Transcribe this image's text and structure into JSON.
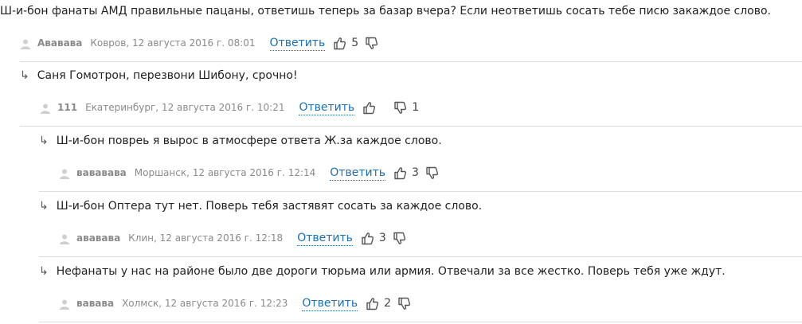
{
  "comments": [
    {
      "arrow": "",
      "text": "Ш-и-бон фанаты АМД правильные пацаны, ответишь теперь за базар вчера? Если неответишь сосать тебе писю закаждое слово.",
      "author": "Ававава",
      "location": "Ковров, 12 августа 2016 г. 08:01",
      "reply": "Ответить",
      "likes": "5",
      "dislikes": ""
    },
    {
      "arrow": "↳",
      "text": "Саня Гомотрон, перезвони Шибону, срочно!",
      "author": "111",
      "location": "Екатеринбург, 12 августа 2016 г. 10:21",
      "reply": "Ответить",
      "likes": "",
      "dislikes": "1"
    },
    {
      "arrow": "↳",
      "text": "Ш-и-бон повреь я вырос в атмосфере ответа Ж.за каждое слово.",
      "author": "вававава",
      "location": "Моршанск, 12 августа 2016 г. 12:14",
      "reply": "Ответить",
      "likes": "3",
      "dislikes": ""
    },
    {
      "arrow": "↳",
      "text": "Ш-и-бон Оптера тут нет. Поверь тебя застявят сосать за каждое слово.",
      "author": "ававава",
      "location": "Клин, 12 августа 2016 г. 12:18",
      "reply": "Ответить",
      "likes": "3",
      "dislikes": ""
    },
    {
      "arrow": "↳",
      "text": "Нефанаты у нас на районе было две дороги тюрьма или армия. Отвечали за все жестко. Поверь тебя уже ждут.",
      "author": "вавава",
      "location": "Холмск, 12 августа 2016 г. 12:23",
      "reply": "Ответить",
      "likes": "2",
      "dislikes": ""
    }
  ],
  "icons": {
    "author": "user-icon",
    "like": "thumbs-up-icon",
    "dislike": "thumbs-down-icon"
  },
  "colors": {
    "reply_link": "#1a6fb8",
    "meta_text": "#8a8a8a",
    "divider": "#dddddd"
  }
}
